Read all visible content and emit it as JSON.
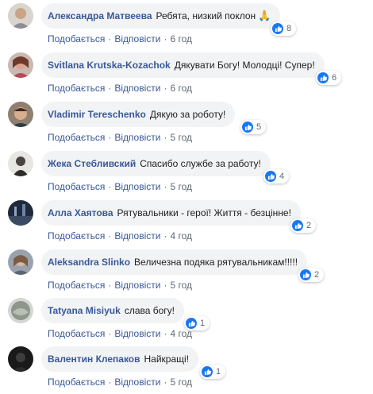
{
  "actions": {
    "like": "Подобається",
    "reply": "Відповісти",
    "separator": "·"
  },
  "comments": [
    {
      "author": "Александра Матвеева",
      "text": "Ребята, низкий поклон",
      "emoji": "🙏",
      "reactions": "8",
      "time": "6 год"
    },
    {
      "author": "Svitlana Krutska-Kozachok",
      "text": "Дякувати Богу! Молодці! Супер!",
      "reactions": "6",
      "time": "6 год"
    },
    {
      "author": "Vladimir Tereschenko",
      "text": "Дякую за роботу!",
      "reactions": "5",
      "time": "5 год"
    },
    {
      "author": "Жека Стебливский",
      "text": "Спасибо службе за работу!",
      "reactions": "4",
      "time": "5 год"
    },
    {
      "author": "Алла Хаятова",
      "text": "Рятувальники - герої! Життя - безцінне!",
      "reactions": "2",
      "time": "4 год"
    },
    {
      "author": "Aleksandra Slinko",
      "text": "Величезна подяка рятувальникам!!!!!",
      "reactions": "2",
      "time": "5 год"
    },
    {
      "author": "Tatyana Misiyuk",
      "text": "слава богу!",
      "reactions": "1",
      "time": "4 год"
    },
    {
      "author": "Валентин Клепаков",
      "text": "Найкращі!",
      "reactions": "1",
      "time": "5 год"
    }
  ],
  "colors": {
    "link": "#385898",
    "bubble": "#f2f3f5",
    "like": "#1877f2",
    "meta": "#606770"
  }
}
